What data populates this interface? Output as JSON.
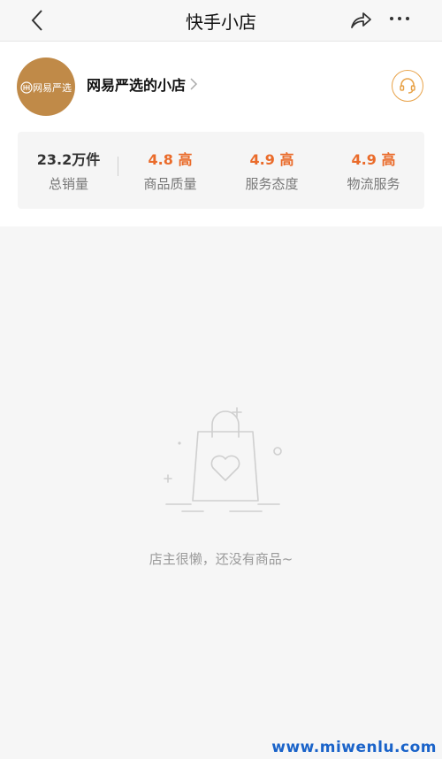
{
  "header": {
    "title": "快手小店"
  },
  "shop": {
    "avatar_text": "网易严选",
    "name": "网易严选的小店"
  },
  "stats": [
    {
      "value": "23.2万件",
      "label": "总销量"
    },
    {
      "value": "4.8 高",
      "label": "商品质量"
    },
    {
      "value": "4.9 高",
      "label": "服务态度"
    },
    {
      "value": "4.9 高",
      "label": "物流服务"
    }
  ],
  "empty_state": {
    "message": "店主很懒，还没有商品~"
  },
  "watermark": "www.miwenlu.com",
  "colors": {
    "accent": "#ea6b2a",
    "avatar_bg": "#c08a48",
    "service_ring": "#e8a34a",
    "watermark": "#1a63c9"
  }
}
